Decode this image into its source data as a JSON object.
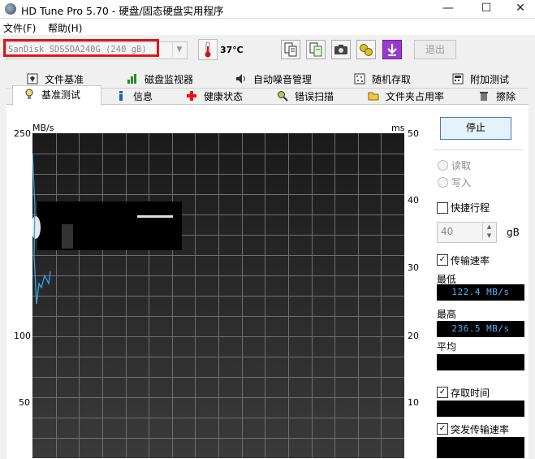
{
  "window": {
    "title": "HD Tune Pro 5.70 - 硬盘/固态硬盘实用程序",
    "minimize": "—",
    "maximize": "☐",
    "close": "✕"
  },
  "menu": [
    "文件(F)",
    "帮助(H)"
  ],
  "toolbar": {
    "drive": "SanDisk SDSSDA240G (240 gB)",
    "temperature": "37℃",
    "exit_label": "退出",
    "icons": [
      "thermometer-icon",
      "copy-info-icon",
      "copy-text-icon",
      "camera-icon",
      "options-icon",
      "save-icon"
    ]
  },
  "tabs_row1": [
    "文件基准",
    "磁盘监视器",
    "自动噪音管理",
    "随机存取",
    "附加测试"
  ],
  "tabs_row2": [
    "基准测试",
    "信息",
    "健康状态",
    "错误扫描",
    "文件夹占用率",
    "擦除"
  ],
  "chart": {
    "left_unit": "MB/s",
    "right_unit": "ms",
    "left_ticks": [
      "250",
      "100",
      "50"
    ],
    "right_ticks": [
      "50",
      "40",
      "30",
      "20",
      "10"
    ]
  },
  "controls": {
    "stop_label": "停止",
    "read_label": "读取",
    "write_label": "写入",
    "quick_label": "快捷行程",
    "quick_value": "40",
    "quick_unit": "gB",
    "transfer_label": "传输速率",
    "min_label": "最低",
    "min_value": "122.4 MB/s",
    "max_label": "最高",
    "max_value": "236.5 MB/s",
    "avg_label": "平均",
    "avg_value": "",
    "access_label": "存取时间",
    "burst_label": "突发传输速率"
  },
  "colors": {
    "chart_bg": "#2b2b2b",
    "grid": "#6e6e6e",
    "trace": "#37a6e6",
    "highlight": "#e0151b"
  }
}
